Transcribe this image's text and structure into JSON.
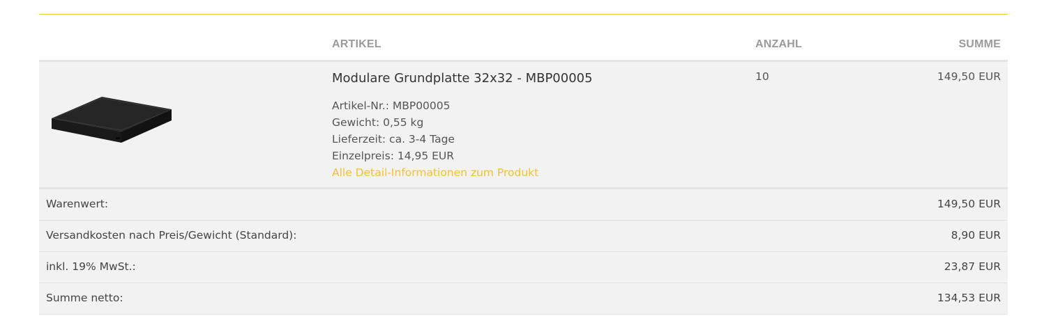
{
  "table": {
    "headers": {
      "artikel": "ARTIKEL",
      "anzahl": "ANZAHL",
      "summe": "SUMME"
    },
    "item": {
      "image_icon": "product-image",
      "name": "Modulare Grundplatte 32x32 - MBP00005",
      "details": [
        "Artikel-Nr.: MBP00005",
        "Gewicht: 0,55 kg",
        "Lieferzeit: ca. 3-4 Tage",
        "Einzelpreis: 14,95 EUR"
      ],
      "detail_link": "Alle Detail-Informationen zum Produkt",
      "quantity": "10",
      "sum": "149,50 EUR"
    }
  },
  "totals": [
    {
      "label": "Warenwert:",
      "value": "149,50 EUR"
    },
    {
      "label": "Versandkosten nach Preis/Gewicht (Standard):",
      "value": "8,90 EUR"
    },
    {
      "label": "inkl. 19% MwSt.:",
      "value": "23,87 EUR"
    },
    {
      "label": "Summe netto:",
      "value": "134,53 EUR"
    }
  ],
  "colors": {
    "accent": "#f2c12e",
    "row_background": "#f2f2f2",
    "header_text": "#9a9a9a"
  }
}
